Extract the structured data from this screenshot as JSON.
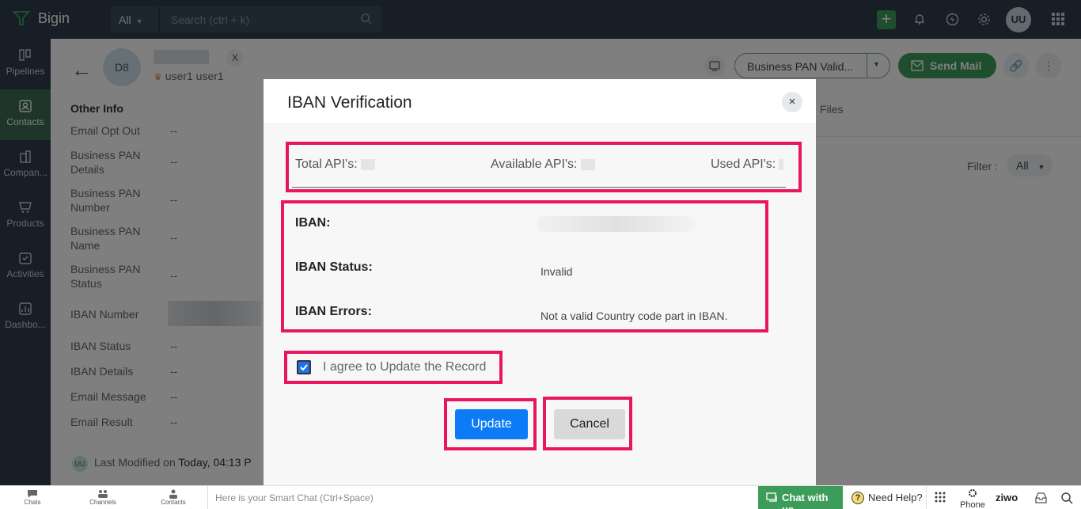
{
  "app": {
    "name": "Bigin",
    "scope": "All",
    "search_placeholder": "Search (ctrl + k)",
    "user_initials": "UU"
  },
  "nav": [
    {
      "label": "Pipelines",
      "icon": "pipelines-icon"
    },
    {
      "label": "Contacts",
      "icon": "contacts-icon",
      "active": true
    },
    {
      "label": "Compan...",
      "icon": "companies-icon"
    },
    {
      "label": "Products",
      "icon": "products-icon"
    },
    {
      "label": "Activities",
      "icon": "activities-icon"
    },
    {
      "label": "Dashbo...",
      "icon": "dashboards-icon"
    }
  ],
  "record": {
    "avatar": "D8",
    "owner": "user1 user1",
    "x_label": "X",
    "action_select": "Business PAN Valid...",
    "send_mail": "Send Mail",
    "files_tab": "Files",
    "filter_label": "Filter :",
    "filter_value": "All",
    "section_title": "Other Info",
    "fields": [
      {
        "label": "Email Opt Out",
        "value": "--"
      },
      {
        "label": "Business PAN Details",
        "value": "--"
      },
      {
        "label": "Business PAN Number",
        "value": "--"
      },
      {
        "label": "Business PAN Name",
        "value": "--"
      },
      {
        "label": "Business PAN Status",
        "value": "--"
      },
      {
        "label": "IBAN Number",
        "value": ""
      },
      {
        "label": "IBAN Status",
        "value": "--"
      },
      {
        "label": "IBAN Details",
        "value": "--"
      },
      {
        "label": "Email Message",
        "value": "--"
      },
      {
        "label": "Email Result",
        "value": "--"
      }
    ],
    "modified_initials": "UU",
    "modified_prefix": "Last Modified on",
    "modified_time": "Today, 04:13 P"
  },
  "modal": {
    "title": "IBAN Verification",
    "close": "×",
    "api": {
      "total_label": "Total API's:",
      "available_label": "Available API's:",
      "used_label": "Used API's:"
    },
    "iban_label": "IBAN:",
    "status_label": "IBAN Status:",
    "status_value": "Invalid",
    "errors_label": "IBAN Errors:",
    "errors_value": "Not a valid Country code part in IBAN.",
    "agree_label": "I agree to Update the Record",
    "agree_checked": true,
    "update_button": "Update",
    "cancel_button": "Cancel",
    "highlight_color": "#e8175d"
  },
  "bottom": {
    "chats": "Chats",
    "channels": "Channels",
    "contacts": "Contacts",
    "smart_chat_placeholder": "Here is your Smart Chat (Ctrl+Space)",
    "chat_with_us": "Chat with us",
    "need_help": "Need Help?",
    "phone": "Phone",
    "ziwo": "ziwo"
  },
  "colors": {
    "topbar": "#2f3d4c",
    "accent_green": "#3c9c5a",
    "primary_blue": "#0b7cf5"
  }
}
